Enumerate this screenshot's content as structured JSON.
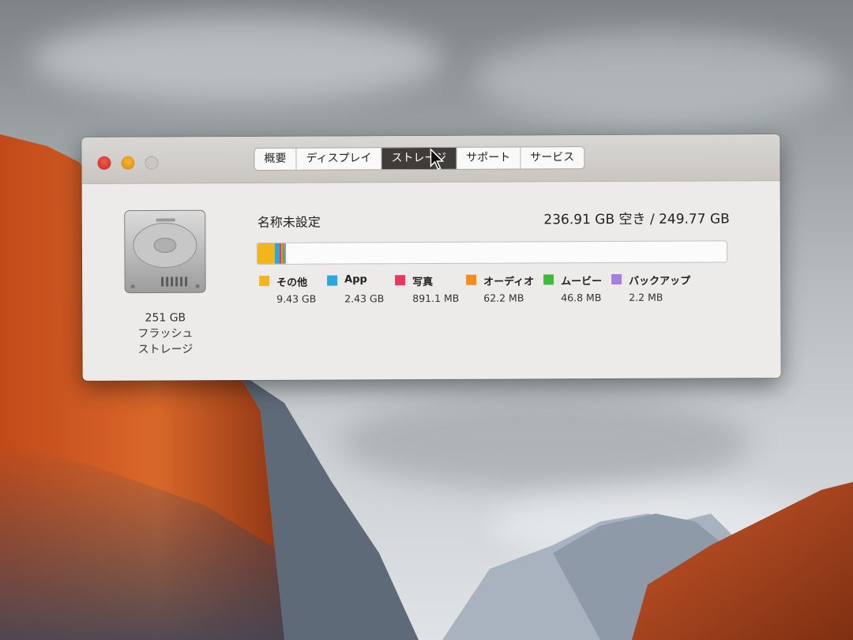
{
  "window": {
    "tabs": [
      {
        "label": "概要",
        "active": false
      },
      {
        "label": "ディスプレイ",
        "active": false
      },
      {
        "label": "ストレージ",
        "active": true
      },
      {
        "label": "サポート",
        "active": false
      },
      {
        "label": "サービス",
        "active": false
      }
    ]
  },
  "drive": {
    "capacity": "251 GB",
    "type_line1": "フラッシュ",
    "type_line2": "ストレージ"
  },
  "volume": {
    "name": "名称未設定",
    "capacity_text": "236.91 GB 空き / 249.77 GB"
  },
  "storage": {
    "categories": [
      {
        "label": "その他",
        "size": "9.43 GB",
        "color": "#f2b61c",
        "gb": 9.43
      },
      {
        "label": "App",
        "size": "2.43 GB",
        "color": "#2aa7dd",
        "gb": 2.43
      },
      {
        "label": "写真",
        "size": "891.1 MB",
        "color": "#e8365e",
        "gb": 0.8911
      },
      {
        "label": "オーディオ",
        "size": "62.2 MB",
        "color": "#f08c22",
        "gb": 0.0622
      },
      {
        "label": "ムービー",
        "size": "46.8 MB",
        "color": "#3dbb3d",
        "gb": 0.0468
      },
      {
        "label": "バックアップ",
        "size": "2.2 MB",
        "color": "#a57fe0",
        "gb": 0.0022
      }
    ],
    "total_gb": 249.77
  },
  "colors": {
    "close": "#e0443a",
    "minimize": "#f0a428",
    "active_tab": "#3f3c3a"
  }
}
